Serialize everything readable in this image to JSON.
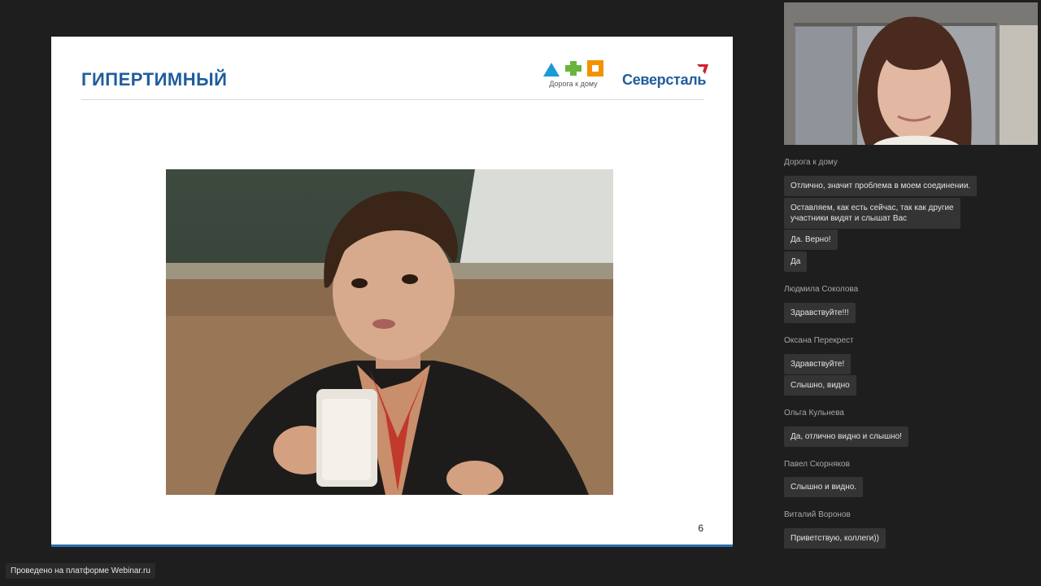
{
  "slide": {
    "title": "ГИПЕРТИМНЫЙ",
    "page_number": "6",
    "logo_road_text": "Дорога к дому",
    "logo_brand_text": "Северсталь",
    "photo_icon": "photo-boy-with-milk"
  },
  "camera": {
    "icon": "webcam-presenter"
  },
  "chat": {
    "messages": [
      {
        "author": "Дорога к дому",
        "texts": [
          "Отлично, значит проблема в моем соединении.",
          "Оставляем, как есть сейчас, так как другие\nучастники видят и слышат Вас",
          "Да. Верно!",
          "Да"
        ]
      },
      {
        "author": "Людмила Соколова",
        "texts": [
          "Здравствуйте!!!"
        ]
      },
      {
        "author": "Оксана Перекрест",
        "texts": [
          "Здравствуйте!",
          "Слышно, видно"
        ]
      },
      {
        "author": "Ольга Кульнева",
        "texts": [
          "Да, отлично видно и слышно!"
        ]
      },
      {
        "author": "Павел Скорняков",
        "texts": [
          "Слышно и видно."
        ]
      },
      {
        "author": "Виталий Воронов",
        "texts": [
          "Приветствую, коллеги))"
        ]
      }
    ]
  },
  "footer": {
    "badge": "Проведено на платформе Webinar.ru"
  },
  "colors": {
    "title": "#1f5d9c",
    "chat_bubble": "#343434",
    "background": "#1e1e1e"
  }
}
